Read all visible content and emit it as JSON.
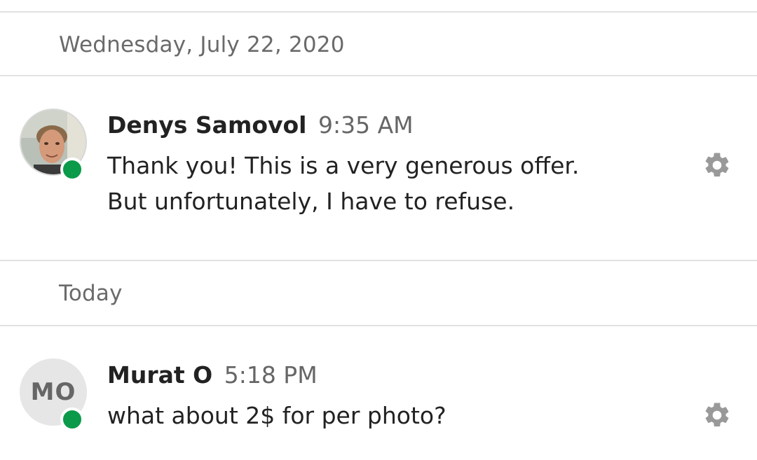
{
  "dividers": [
    {
      "label": "Wednesday, July 22, 2020"
    },
    {
      "label": "Today"
    }
  ],
  "messages": [
    {
      "author": "Denys Samovol",
      "time": "9:35 AM",
      "lines": [
        "Thank you! This is a very generous offer.",
        "But unfortunately, I have to refuse."
      ],
      "avatar_icon": "user-photo",
      "presence": "online"
    },
    {
      "author": "Murat O",
      "time": "5:18 PM",
      "lines": [
        "what about 2$ for per photo?"
      ],
      "avatar_initials": "MO",
      "presence": "online"
    }
  ],
  "colors": {
    "presence_online": "#0a9a4a",
    "divider_line": "#e2e2e2",
    "muted_text": "#6a6a6a",
    "gear_icon": "#999999"
  }
}
